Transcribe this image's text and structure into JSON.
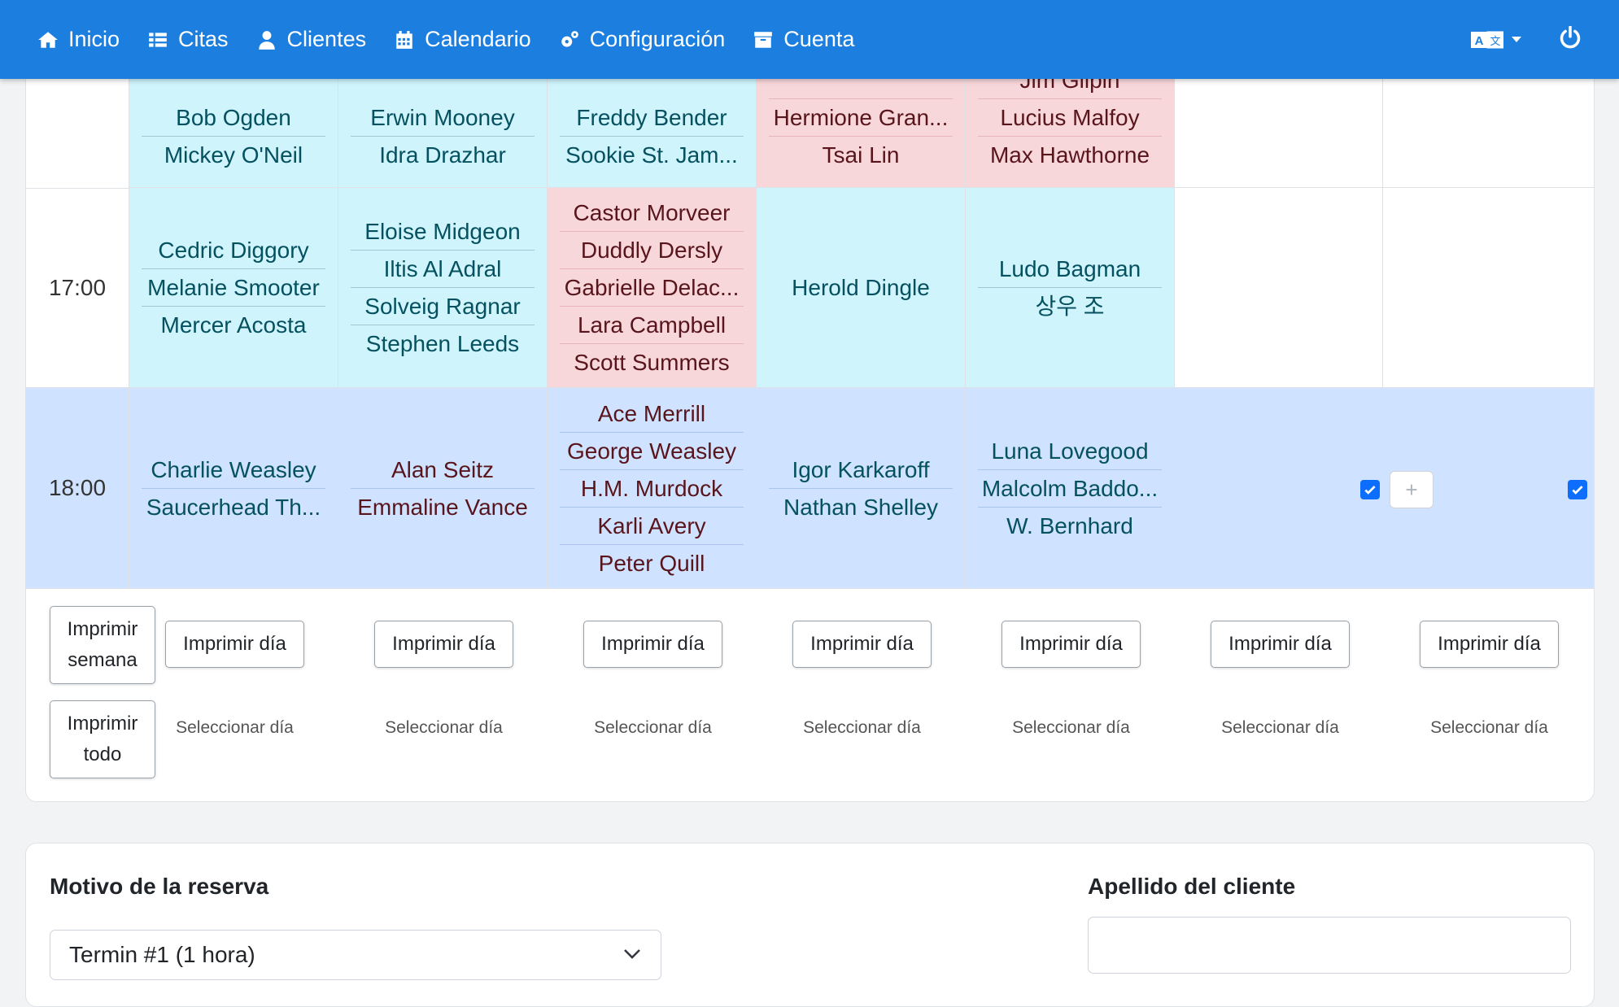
{
  "nav": {
    "items": [
      {
        "label": "Inicio",
        "icon": "home-icon"
      },
      {
        "label": "Citas",
        "icon": "list-icon"
      },
      {
        "label": "Clientes",
        "icon": "user-icon"
      },
      {
        "label": "Calendario",
        "icon": "calendar-icon"
      },
      {
        "label": "Configuración",
        "icon": "cogs-icon"
      },
      {
        "label": "Cuenta",
        "icon": "archive-icon"
      }
    ]
  },
  "schedule": {
    "rows": [
      {
        "time": "",
        "slots": [
          {
            "color": "cyan",
            "names": [
              "Bob Ogden",
              "Mickey O'Neil"
            ]
          },
          {
            "color": "cyan",
            "names": [
              "Erwin Mooney",
              "Idra Drazhar"
            ]
          },
          {
            "color": "cyan",
            "names": [
              "Freddy Bender",
              "Sookie St. Jam..."
            ]
          },
          {
            "color": "pink",
            "names": [
              "Hermione Gran...",
              "Tsai Lin"
            ]
          },
          {
            "color": "pink",
            "names": [
              "Jim Gilpin",
              "Lucius Malfoy",
              "Max Hawthorne"
            ]
          },
          {
            "color": "none",
            "names": []
          },
          {
            "color": "none",
            "names": []
          }
        ]
      },
      {
        "time": "17:00",
        "slots": [
          {
            "color": "cyan",
            "names": [
              "Cedric Diggory",
              "Melanie Smooter",
              "Mercer Acosta"
            ]
          },
          {
            "color": "cyan",
            "names": [
              "Eloise Midgeon",
              "Iltis Al Adral",
              "Solveig Ragnar",
              "Stephen Leeds"
            ]
          },
          {
            "color": "pink",
            "names": [
              "Castor Morveer",
              "Duddly Dersly",
              "Gabrielle Delac...",
              "Lara Campbell",
              "Scott Summers"
            ]
          },
          {
            "color": "cyan",
            "names": [
              "Herold Dingle"
            ]
          },
          {
            "color": "cyan",
            "names": [
              "Ludo Bagman",
              "상우 조"
            ]
          },
          {
            "color": "none",
            "names": []
          },
          {
            "color": "none",
            "names": []
          }
        ]
      },
      {
        "time": "18:00",
        "slots": [
          {
            "text": "teal",
            "names": [
              "Charlie Weasley",
              "Saucerhead Th..."
            ]
          },
          {
            "text": "maroon",
            "names": [
              "Alan Seitz",
              "Emmaline Vance"
            ]
          },
          {
            "text": "maroon",
            "names": [
              "Ace Merrill",
              "George Weasley",
              "H.M. Murdock",
              "Karli Avery",
              "Peter Quill"
            ]
          },
          {
            "text": "teal",
            "names": [
              "Igor Karkaroff",
              "Nathan Shelley"
            ]
          },
          {
            "text": "teal",
            "names": [
              "Luna Lovegood",
              "Malcolm Baddo...",
              "W. Bernhard"
            ]
          },
          {
            "text": "teal",
            "names": []
          },
          {
            "text": "teal",
            "names": []
          }
        ]
      }
    ],
    "add_label": "+"
  },
  "print": {
    "week_label": "Imprimir semana",
    "all_label": "Imprimir todo",
    "day_label": "Imprimir día",
    "select_day_label": "Seleccionar día"
  },
  "form": {
    "reason_label": "Motivo de la reserva",
    "reason_value": "Termin #1 (1 hora)",
    "lastname_label": "Apellido del cliente",
    "lastname_value": ""
  }
}
